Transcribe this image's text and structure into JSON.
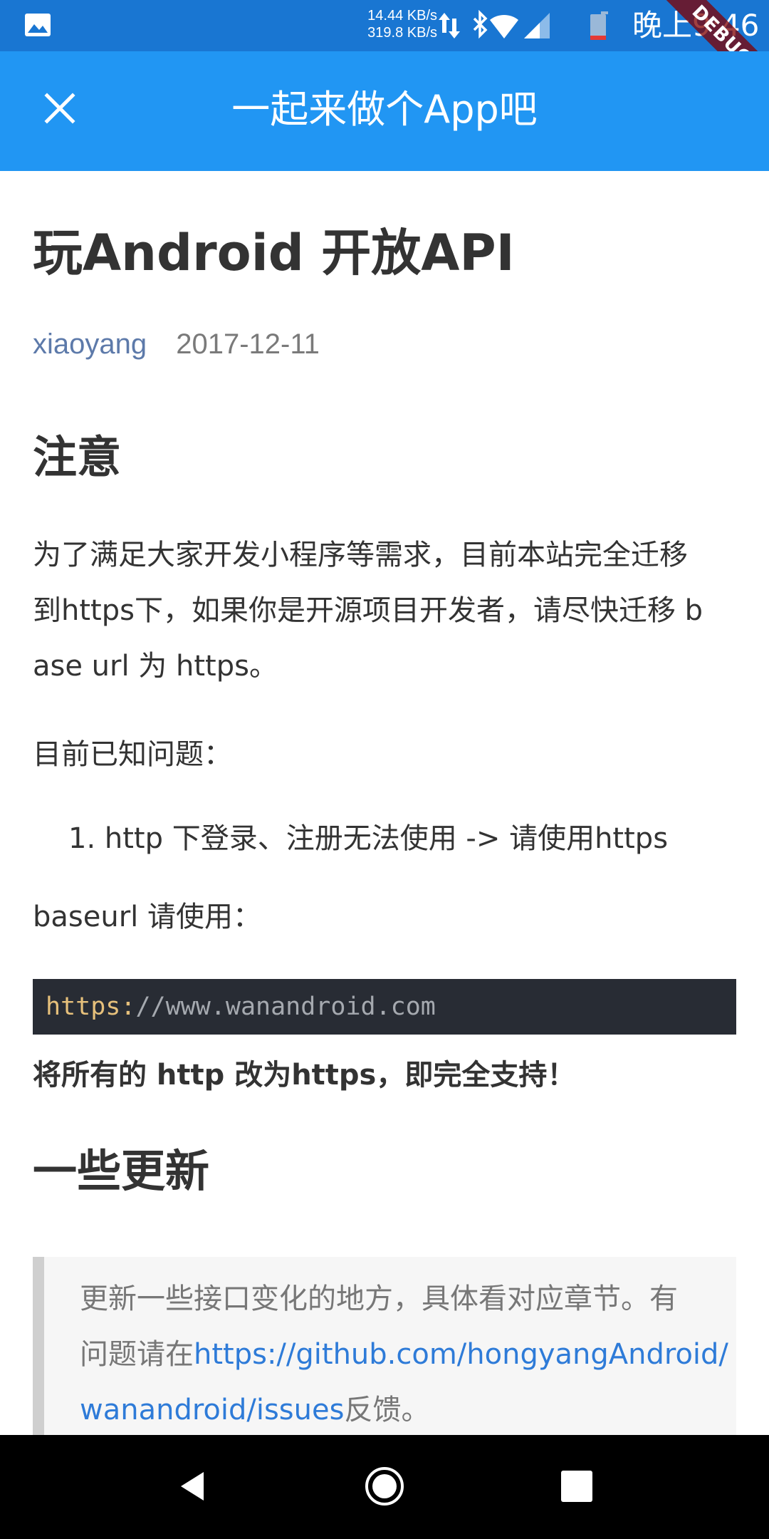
{
  "status_bar": {
    "speed_up": "14.44 KB/s",
    "speed_down": "319.8 KB/s",
    "time": "晚上9:46",
    "debug_label": "DEBUG",
    "icons": [
      "image-icon",
      "data-transfer-icon",
      "bluetooth-icon",
      "wifi-icon",
      "signal-icon",
      "battery-icon"
    ]
  },
  "app_bar": {
    "title": "一起来做个App吧",
    "close_icon": "close-icon"
  },
  "article": {
    "title": "玩Android 开放API",
    "author": "xiaoyang",
    "date": "2017-12-11",
    "section1_heading": "注意",
    "para1_lines": [
      "为了满足大家开发小程序等需求，目前本站完全迁移",
      "到https下，如果你是开源项目开发者，请尽快迁移 b",
      "ase url 为 https。"
    ],
    "known_issues_label": "目前已知问题：",
    "list_items": [
      "1. http 下登录、注册无法使用 -> 请使用https"
    ],
    "baseurl_label": "baseurl 请使用：",
    "code": {
      "scheme": "https:",
      "rest": "//www.wanandroid.com"
    },
    "bold_note": "将所有的 http 改为https，即完全支持！",
    "section2_heading": "一些更新",
    "blockquote": {
      "line1": "更新一些接口变化的地方，具体看对应章节。有",
      "line2_prefix": "问题请在",
      "link_part1": "https://github.com/hongyangAndroid/",
      "link_part2": "wanandroid/issues",
      "line3_suffix": "反馈。"
    }
  },
  "nav_bar": {
    "icons": [
      "back-icon",
      "home-icon",
      "recents-icon"
    ]
  },
  "colors": {
    "status_bar": "#1976d2",
    "app_bar": "#2196f3",
    "text": "#333333",
    "author": "#5d7aaa",
    "code_bg": "#282c34",
    "link": "#2e7bd8"
  }
}
